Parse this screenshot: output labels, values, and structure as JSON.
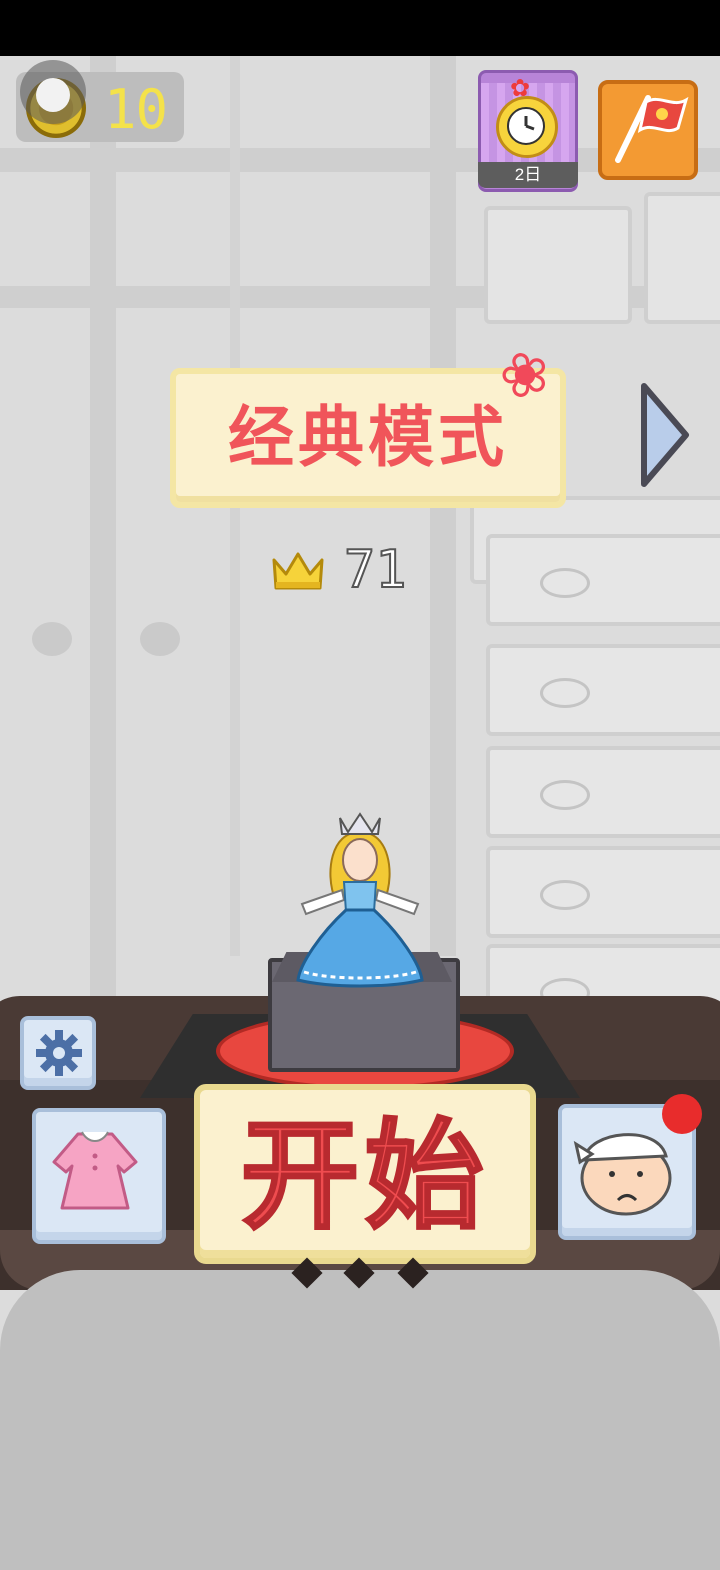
{
  "hud": {
    "coins": "10",
    "daily_reward_label": "2日"
  },
  "mode": {
    "title": "经典模式"
  },
  "best": {
    "score": "71"
  },
  "actions": {
    "start_label": "开始"
  },
  "icons": {
    "coin": "coin-icon",
    "clock": "clock-icon",
    "flag": "flag-icon",
    "next": "right-arrow-icon",
    "crown": "crown-icon",
    "settings": "gear-icon",
    "dress": "dress-icon",
    "chef": "chef-icon"
  },
  "colors": {
    "accent_red": "#ef4c4f",
    "panel_cream": "#fbf1cf",
    "coin_gold": "#f4e24a"
  }
}
